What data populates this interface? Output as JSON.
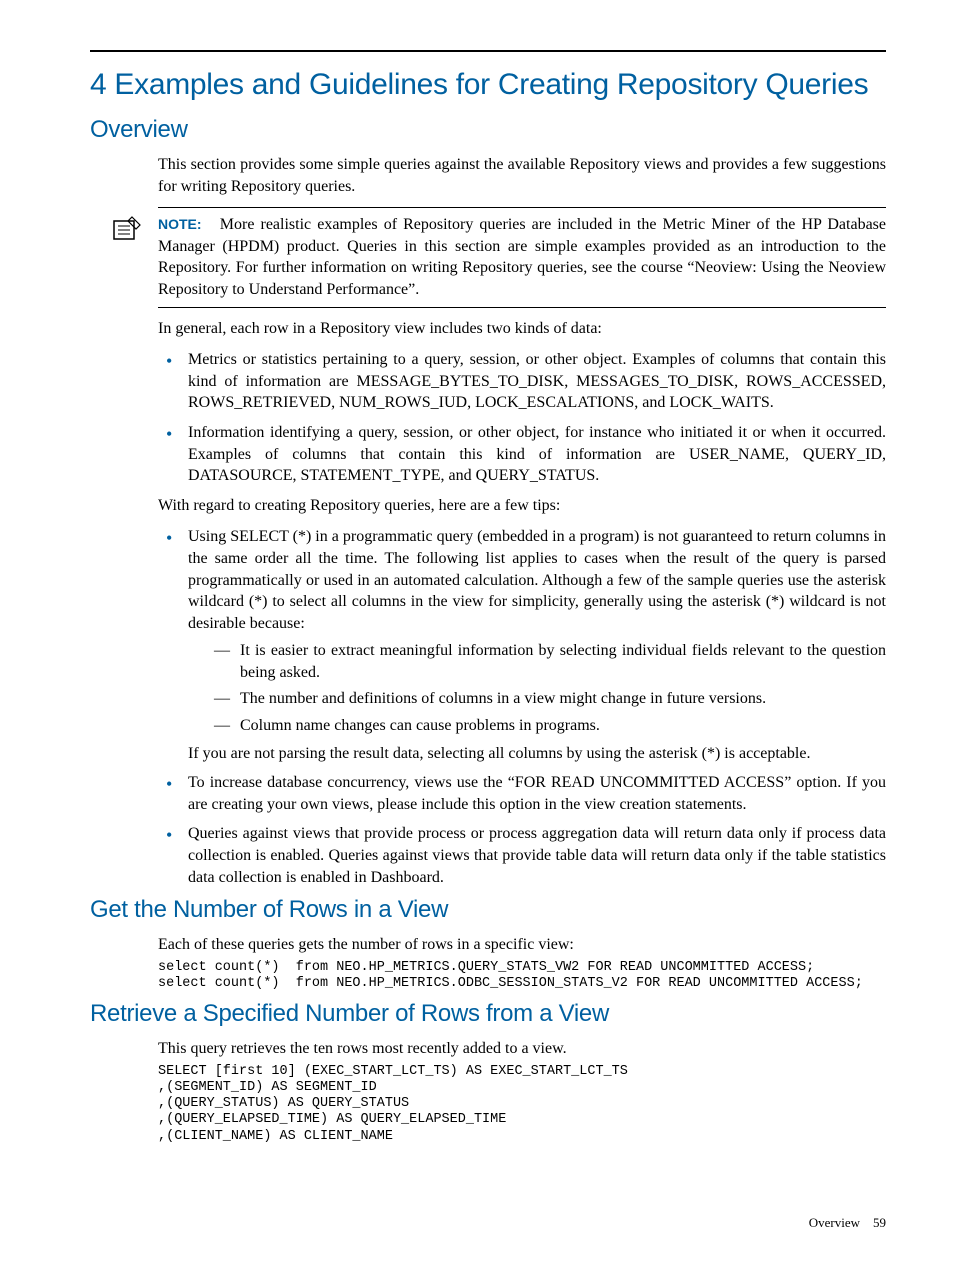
{
  "chapter": {
    "title": "4 Examples and Guidelines for Creating Repository Queries"
  },
  "overview": {
    "heading": "Overview",
    "intro": "This section provides some simple queries against the available Repository views and provides a few suggestions for writing Repository queries.",
    "note": {
      "label": "NOTE:",
      "text": "More realistic examples of Repository queries are included in the Metric Miner of the HP Database Manager (HPDM) product. Queries in this section are simple examples provided as an introduction to the Repository. For further information on writing Repository queries, see the course “Neoview: Using the Neoview Repository to Understand Performance”."
    },
    "after_note": "In general, each row in a Repository view includes two kinds of data:",
    "data_kinds": [
      "Metrics or statistics pertaining to a query, session, or other object. Examples of columns that contain this kind of information are MESSAGE_BYTES_TO_DISK, MESSAGES_TO_DISK, ROWS_ACCESSED, ROWS_RETRIEVED, NUM_ROWS_IUD, LOCK_ESCALATIONS, and LOCK_WAITS.",
      "Information identifying a query, session, or other object, for instance who initiated it or when it occurred. Examples of columns that contain this kind of information are USER_NAME, QUERY_ID, DATASOURCE, STATEMENT_TYPE, and QUERY_STATUS."
    ],
    "tips_intro": "With regard to creating Repository queries, here are a few tips:",
    "tips": {
      "t0": {
        "text": "Using SELECT (*) in a programmatic query (embedded in a program) is not guaranteed to return columns in the same order all the time. The following list applies to cases when the result of the query is parsed programmatically or used in an automated calculation. Although a few of the sample queries use the asterisk wildcard (*) to select all columns in the view for simplicity, generally using the asterisk (*) wildcard is not desirable because:",
        "dashes": [
          "It is easier to extract meaningful information by selecting individual fields relevant to the question being asked.",
          "The number and definitions of columns in a view might change in future versions.",
          "Column name changes can cause problems in programs."
        ],
        "after": "If you are not parsing the result data, selecting all columns by using the asterisk (*) is acceptable."
      },
      "t1": "To increase database concurrency, views use the “FOR READ UNCOMMITTED ACCESS” option. If you are creating your own views, please include this option in the view creation statements.",
      "t2": "Queries against views that provide process or process aggregation data will return data only if process data collection is enabled. Queries against views that provide table data will return data only if the table statistics data collection is enabled in Dashboard."
    }
  },
  "section_rows": {
    "heading": "Get the Number of Rows in a View",
    "intro": "Each of these queries gets the number of rows in a specific view:",
    "code": "select count(*)  from NEO.HP_METRICS.QUERY_STATS_VW2 FOR READ UNCOMMITTED ACCESS;\nselect count(*)  from NEO.HP_METRICS.ODBC_SESSION_STATS_V2 FOR READ UNCOMMITTED ACCESS;"
  },
  "section_retrieve": {
    "heading": "Retrieve a Specified Number of Rows from a View",
    "intro": "This query retrieves the ten rows most recently added to a view.",
    "code": "SELECT [first 10] (EXEC_START_LCT_TS) AS EXEC_START_LCT_TS\n,(SEGMENT_ID) AS SEGMENT_ID\n,(QUERY_STATUS) AS QUERY_STATUS\n,(QUERY_ELAPSED_TIME) AS QUERY_ELAPSED_TIME\n,(CLIENT_NAME) AS CLIENT_NAME"
  },
  "footer": {
    "section": "Overview",
    "page": "59"
  }
}
